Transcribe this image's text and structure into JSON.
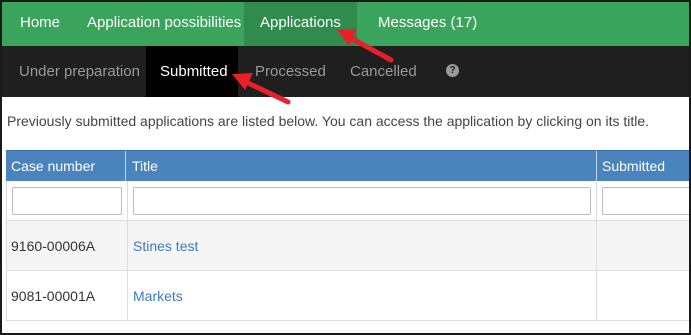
{
  "topnav": {
    "items": [
      {
        "label": "Home"
      },
      {
        "label": "Application possibilities"
      },
      {
        "label": "Applications"
      },
      {
        "label": "Messages (17)"
      }
    ]
  },
  "subnav": {
    "items": [
      {
        "label": "Under preparation"
      },
      {
        "label": "Submitted"
      },
      {
        "label": "Processed"
      },
      {
        "label": "Cancelled"
      }
    ],
    "help_symbol": "?"
  },
  "intro_text": "Previously submitted applications are listed below. You can access the application by clicking on its title.",
  "table": {
    "headers": [
      "Case number",
      "Title",
      "Submitted"
    ],
    "rows": [
      {
        "case_number": "9160-00006A",
        "title": "Stines test",
        "submitted": ""
      },
      {
        "case_number": "9081-00001A",
        "title": "Markets",
        "submitted": ""
      }
    ]
  },
  "colors": {
    "topnav_bg": "#3aa45c",
    "subnav_bg": "#1f1f1f",
    "table_header_bg": "#4a84bd",
    "link": "#3b7bbf",
    "annotation_arrow": "#e8202a"
  },
  "icons": {
    "help": "question-circle-icon",
    "annotation": "red-arrow-icon"
  }
}
